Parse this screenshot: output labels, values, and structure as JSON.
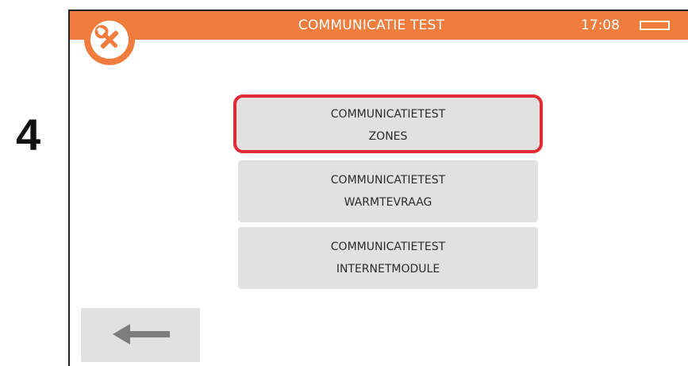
{
  "step": {
    "number": "4"
  },
  "header": {
    "title": "COMMUNICATIE TEST",
    "time": "17:08",
    "badge_icon": "wrench-screwdriver-icon",
    "battery_icon": "battery-icon",
    "accent_color": "#f07c3e"
  },
  "menu": {
    "items": [
      {
        "line1": "COMMUNICATIETEST",
        "line2": "ZONES",
        "selected": true
      },
      {
        "line1": "COMMUNICATIETEST",
        "line2": "WARMTEVRAAG",
        "selected": false
      },
      {
        "line1": "COMMUNICATIETEST",
        "line2": "INTERNETMODULE",
        "selected": false
      }
    ],
    "selection_color": "#e22a35",
    "button_color": "#e1e1e1"
  },
  "footer": {
    "back_icon": "arrow-left-icon"
  }
}
